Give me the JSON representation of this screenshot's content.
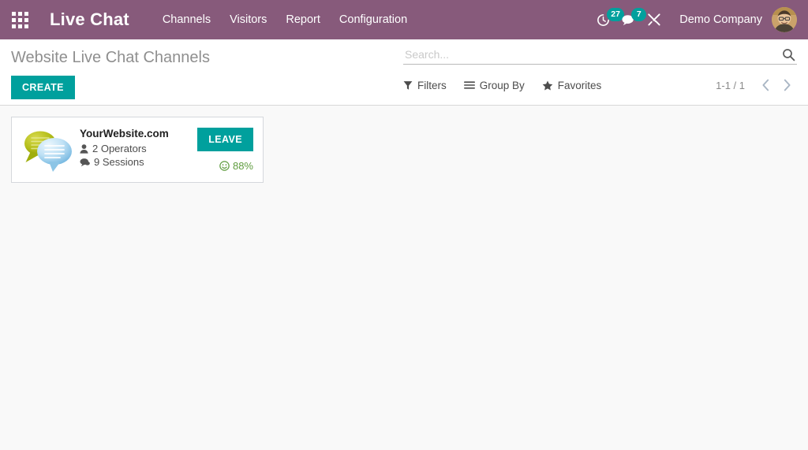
{
  "navbar": {
    "apps_icon": "apps-grid-icon",
    "brand": "Live Chat",
    "menu": [
      {
        "label": "Channels"
      },
      {
        "label": "Visitors"
      },
      {
        "label": "Report"
      },
      {
        "label": "Configuration"
      }
    ],
    "activity": {
      "icon": "clock-activity-icon",
      "count": "27"
    },
    "messages": {
      "icon": "chat-bubble-icon",
      "count": "7"
    },
    "debug": {
      "icon": "tools-wrench-icon"
    },
    "company": "Demo Company",
    "avatar": "user-avatar"
  },
  "control_panel": {
    "title": "Website Live Chat Channels",
    "create_label": "CREATE",
    "search": {
      "placeholder": "Search...",
      "value": "",
      "icon": "search-icon"
    },
    "filters": [
      {
        "label": "Filters",
        "icon": "filter-funnel-icon"
      },
      {
        "label": "Group By",
        "icon": "list-lines-icon"
      },
      {
        "label": "Favorites",
        "icon": "star-icon"
      }
    ],
    "pager": {
      "count": "1-1 / 1",
      "prev_icon": "chevron-left-icon",
      "next_icon": "chevron-right-icon"
    }
  },
  "kanban": {
    "cards": [
      {
        "thumb": "chat-bubbles-image",
        "title": "YourWebsite.com",
        "operators": {
          "icon": "user-icon",
          "label": "2 Operators"
        },
        "sessions": {
          "icon": "comments-icon",
          "label": "9 Sessions"
        },
        "action_label": "LEAVE",
        "rating": {
          "icon": "smiley-face-icon",
          "label": "88%"
        }
      }
    ]
  },
  "colors": {
    "brand_purple": "#875A7B",
    "accent_teal": "#00A09D",
    "rating_green": "#5f9c3f",
    "page_bg": "#f9f9f9"
  }
}
